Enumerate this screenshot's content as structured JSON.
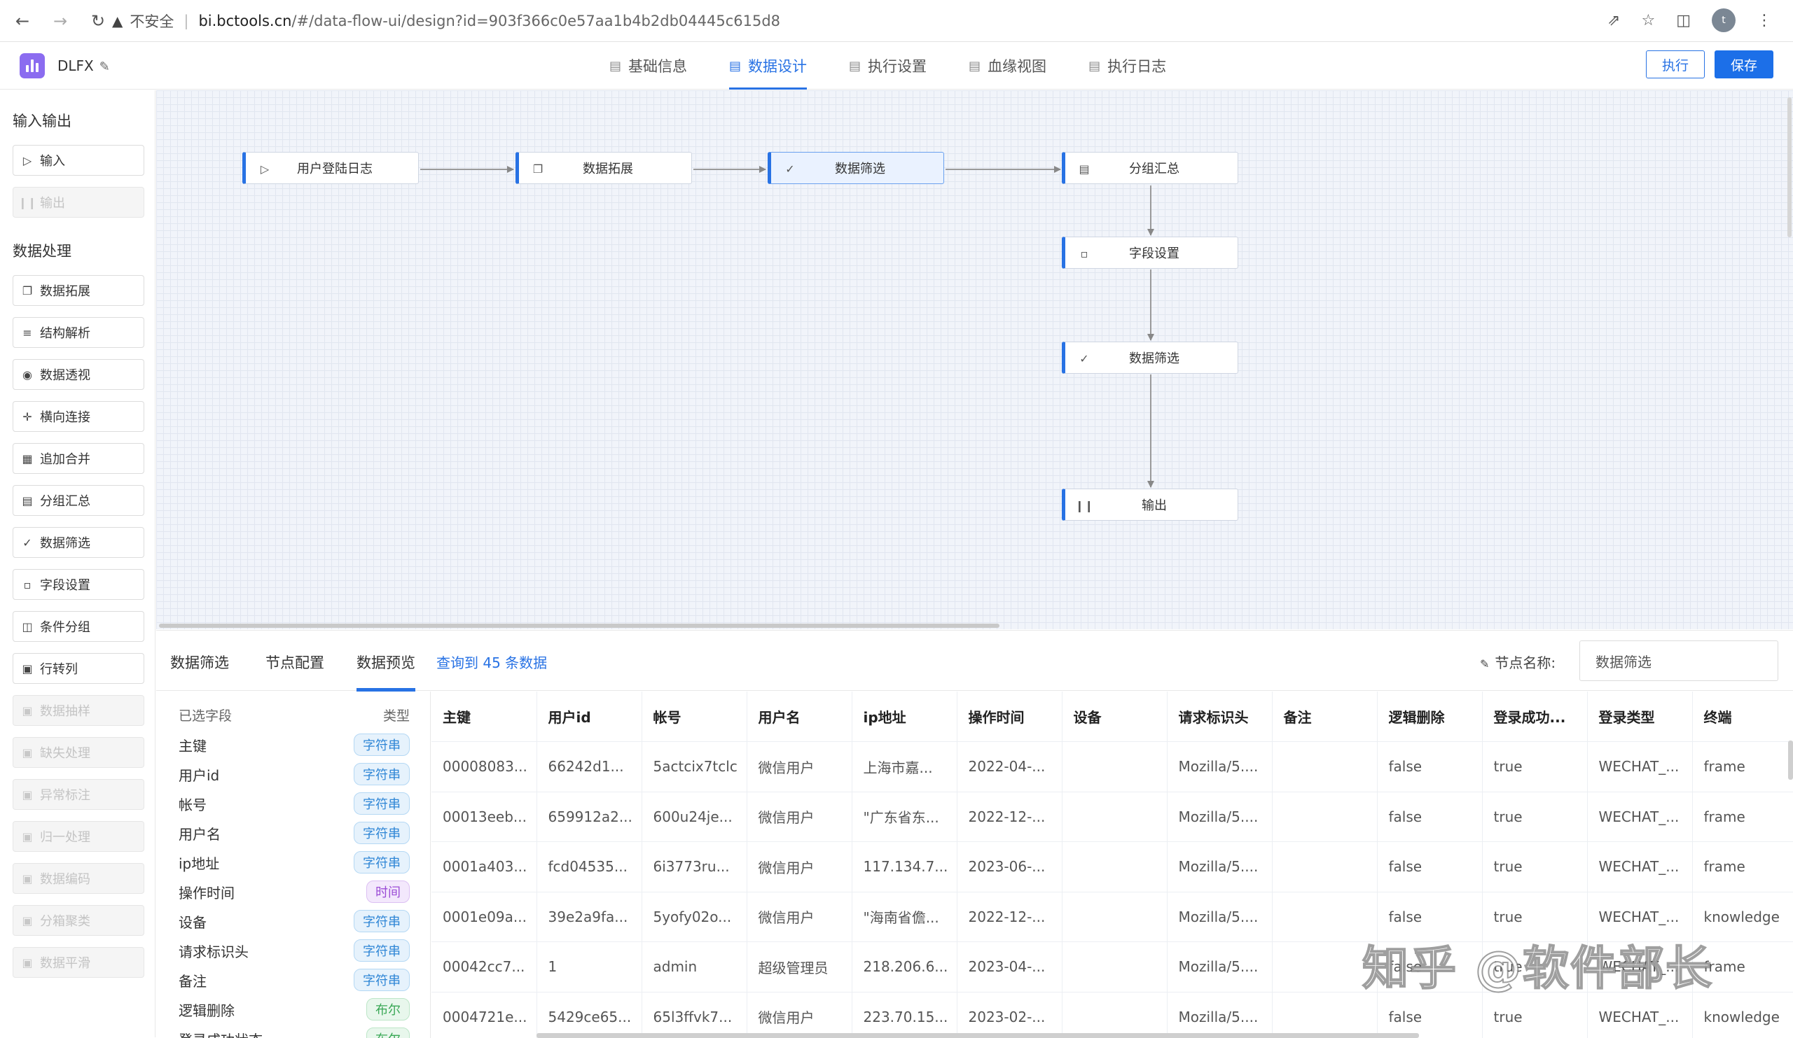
{
  "browser": {
    "insecure_label": "不安全",
    "url_host": "bi.bctools.cn",
    "url_path": "/#/data-flow-ui/design?id=903f366c0e57aa1b4b2db04445c615d8",
    "avatar_initial": "t"
  },
  "app": {
    "name": "DLFX",
    "tabs": [
      {
        "label": "基础信息",
        "active": false
      },
      {
        "label": "数据设计",
        "active": true
      },
      {
        "label": "执行设置",
        "active": false
      },
      {
        "label": "血缘视图",
        "active": false
      },
      {
        "label": "执行日志",
        "active": false
      }
    ],
    "run_label": "执行",
    "save_label": "保存",
    "accent_color": "#2872e4"
  },
  "sidebar": {
    "io_title": "输入输出",
    "io_items": [
      {
        "label": "输入",
        "icon": "play-circle-icon",
        "disabled": false
      },
      {
        "label": "输出",
        "icon": "pause-circle-icon",
        "disabled": true
      }
    ],
    "proc_title": "数据处理",
    "proc_items": [
      {
        "label": "数据拓展",
        "icon": "copy-icon",
        "disabled": false
      },
      {
        "label": "结构解析",
        "icon": "sliders-icon",
        "disabled": false
      },
      {
        "label": "数据透视",
        "icon": "eye-icon",
        "disabled": false
      },
      {
        "label": "横向连接",
        "icon": "move-icon",
        "disabled": false
      },
      {
        "label": "追加合并",
        "icon": "calendar-icon",
        "disabled": false
      },
      {
        "label": "分组汇总",
        "icon": "document-icon",
        "disabled": false
      },
      {
        "label": "数据筛选",
        "icon": "file-check-icon",
        "disabled": false
      },
      {
        "label": "字段设置",
        "icon": "file-icon",
        "disabled": false
      },
      {
        "label": "条件分组",
        "icon": "split-icon",
        "disabled": false
      },
      {
        "label": "行转列",
        "icon": "box-icon",
        "disabled": false
      },
      {
        "label": "数据抽样",
        "icon": "box-icon",
        "disabled": true
      },
      {
        "label": "缺失处理",
        "icon": "box-icon",
        "disabled": true
      },
      {
        "label": "异常标注",
        "icon": "box-icon",
        "disabled": true
      },
      {
        "label": "归一处理",
        "icon": "box-icon",
        "disabled": true
      },
      {
        "label": "数据编码",
        "icon": "box-icon",
        "disabled": true
      },
      {
        "label": "分箱聚类",
        "icon": "box-icon",
        "disabled": true
      },
      {
        "label": "数据平滑",
        "icon": "box-icon",
        "disabled": true
      }
    ]
  },
  "flow": {
    "nodes": [
      {
        "id": "n1",
        "label": "用户登陆日志",
        "icon": "play-circle-icon",
        "selected": false
      },
      {
        "id": "n2",
        "label": "数据拓展",
        "icon": "copy-icon",
        "selected": false
      },
      {
        "id": "n3",
        "label": "数据筛选",
        "icon": "file-check-icon",
        "selected": true
      },
      {
        "id": "n4",
        "label": "分组汇总",
        "icon": "document-icon",
        "selected": false
      },
      {
        "id": "n5",
        "label": "字段设置",
        "icon": "file-icon",
        "selected": false
      },
      {
        "id": "n6",
        "label": "数据筛选",
        "icon": "file-check-icon",
        "selected": false
      },
      {
        "id": "n7",
        "label": "输出",
        "icon": "pause-circle-icon",
        "selected": false
      }
    ]
  },
  "bottom": {
    "tabs": [
      {
        "label": "数据筛选",
        "active": false
      },
      {
        "label": "节点配置",
        "active": false
      },
      {
        "label": "数据预览",
        "active": true
      }
    ],
    "query_info": "查询到 45 条数据",
    "node_name_label": "节点名称:",
    "node_name_value": "数据筛选",
    "fields_header": {
      "selected": "已选字段",
      "type": "类型"
    },
    "fields": [
      {
        "name": "主键",
        "type": "字符串",
        "kind": "str"
      },
      {
        "name": "用户id",
        "type": "字符串",
        "kind": "str"
      },
      {
        "name": "帐号",
        "type": "字符串",
        "kind": "str"
      },
      {
        "name": "用户名",
        "type": "字符串",
        "kind": "str"
      },
      {
        "name": "ip地址",
        "type": "字符串",
        "kind": "str"
      },
      {
        "name": "操作时间",
        "type": "时间",
        "kind": "time"
      },
      {
        "name": "设备",
        "type": "字符串",
        "kind": "str"
      },
      {
        "name": "请求标识头",
        "type": "字符串",
        "kind": "str"
      },
      {
        "name": "备注",
        "type": "字符串",
        "kind": "str"
      },
      {
        "name": "逻辑删除",
        "type": "布尔",
        "kind": "bool"
      },
      {
        "name": "登录成功状态",
        "type": "布尔",
        "kind": "bool"
      }
    ],
    "columns": [
      "主键",
      "用户id",
      "帐号",
      "用户名",
      "ip地址",
      "操作时间",
      "设备",
      "请求标识头",
      "备注",
      "逻辑删除",
      "登录成功...",
      "登录类型",
      "终端"
    ],
    "rows": [
      [
        "00008083...",
        "66242d1...",
        "5actcix7tclc",
        "微信用户",
        "上海市嘉...",
        "2022-04-...",
        "",
        "Mozilla/5....",
        "",
        "false",
        "true",
        "WECHAT_...",
        "frame"
      ],
      [
        "00013eeb...",
        "659912a2...",
        "600u24je...",
        "微信用户",
        "\"广东省东...",
        "2022-12-...",
        "",
        "Mozilla/5....",
        "",
        "false",
        "true",
        "WECHAT_...",
        "frame"
      ],
      [
        "0001a403...",
        "fcd04535...",
        "6i3773ru...",
        "微信用户",
        "117.134.7...",
        "2023-06-...",
        "",
        "Mozilla/5....",
        "",
        "false",
        "true",
        "WECHAT_...",
        "frame"
      ],
      [
        "0001e09a...",
        "39e2a9fa...",
        "5yofy02o...",
        "微信用户",
        "\"海南省儋...",
        "2022-12-...",
        "",
        "Mozilla/5....",
        "",
        "false",
        "true",
        "WECHAT_...",
        "knowledge"
      ],
      [
        "00042cc7...",
        "1",
        "admin",
        "超级管理员",
        "218.206.6...",
        "2023-04-...",
        "",
        "Mozilla/5....",
        "",
        "false",
        "true",
        "WECHAT_...",
        "frame"
      ],
      [
        "0004721e...",
        "5429ce65...",
        "65l3ffvk7...",
        "微信用户",
        "223.70.15...",
        "2023-02-...",
        "",
        "Mozilla/5....",
        "",
        "false",
        "true",
        "WECHAT_...",
        "knowledge"
      ]
    ]
  },
  "watermark": "知乎 @软件部长"
}
